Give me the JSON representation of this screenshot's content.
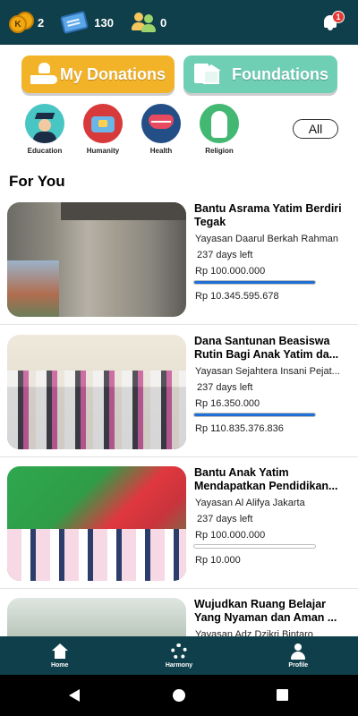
{
  "topbar": {
    "coins": "2",
    "coin_glyph": "K",
    "tickets": "130",
    "friends": "0",
    "notifications": "1"
  },
  "actions": {
    "donations_label": "My Donations",
    "foundations_label": "Foundations"
  },
  "categories": [
    {
      "label": "Education",
      "color": "#48c6c4",
      "icon": "graduate-icon"
    },
    {
      "label": "Humanity",
      "color": "#d8393a",
      "icon": "giving-hands-icon"
    },
    {
      "label": "Health",
      "color": "#244f86",
      "icon": "heart-pulse-icon"
    },
    {
      "label": "Religion",
      "color": "#43b872",
      "icon": "praying-person-icon"
    }
  ],
  "all_label": "All",
  "section_title": "For You",
  "campaigns": [
    {
      "title": "Bantu Asrama Yatim Berdiri Tegak",
      "organization": "Yayasan Daarul Berkah Rahman",
      "days_left": "237 days left",
      "target": "Rp 100.000.000",
      "raised": "Rp 10.345.595.678",
      "progress": 1.0
    },
    {
      "title": "Dana Santunan Beasiswa Rutin Bagi Anak Yatim da...",
      "organization": "Yayasan Sejahtera Insani Pejat...",
      "days_left": "237 days left",
      "target": "Rp 16.350.000",
      "raised": "Rp 110.835.376.836",
      "progress": 1.0
    },
    {
      "title": "Bantu Anak Yatim Mendapatkan Pendidikan...",
      "organization": "Yayasan Al Alifya Jakarta",
      "days_left": "237 days left",
      "target": "Rp 100.000.000",
      "raised": "Rp 10.000",
      "progress": 0.0
    },
    {
      "title": "Wujudkan Ruang Belajar Yang Nyaman dan Aman ...",
      "organization": "Yayasan Adz Dzikri Bintaro",
      "days_left": "",
      "target": "",
      "raised": "",
      "progress": 0.0
    }
  ],
  "bottom_nav": {
    "home": "Home",
    "harmony": "Harmony",
    "profile": "Profile"
  },
  "colors": {
    "topbar_bg": "#0f3f4a",
    "donations_btn": "#f3b329",
    "foundations_btn": "#6fcfb5",
    "progress_fill": "#1f6fd6",
    "badge": "#e53935"
  }
}
